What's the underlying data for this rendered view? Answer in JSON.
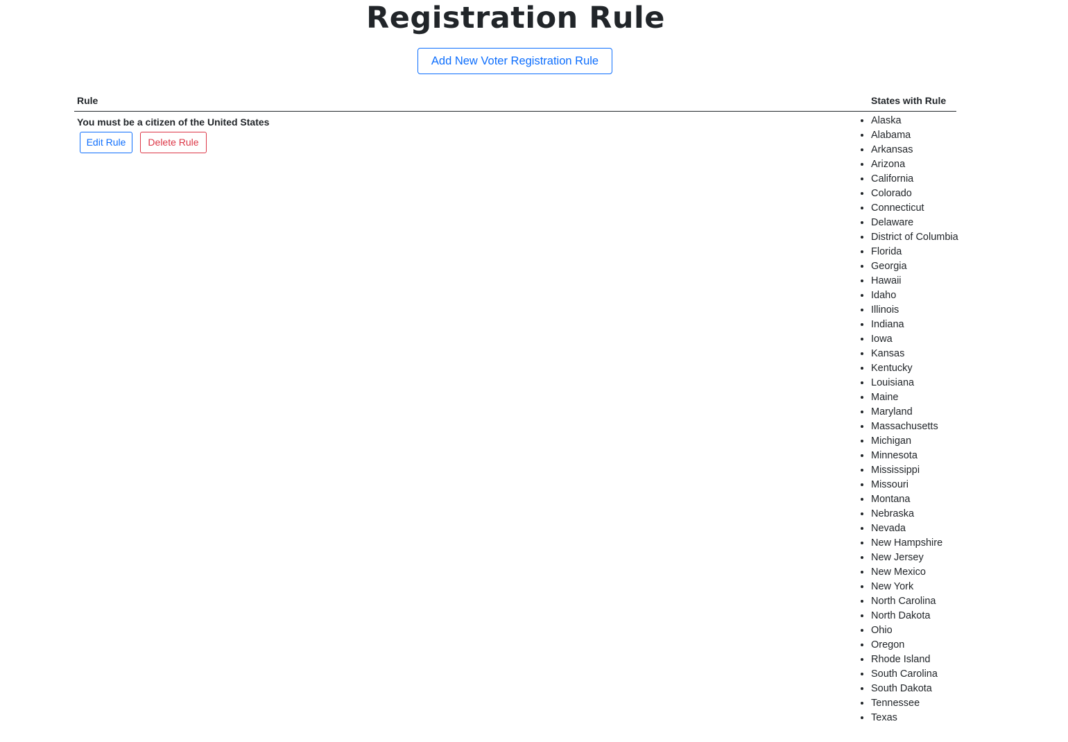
{
  "page": {
    "title": "Registration Rule",
    "add_button_label": "Add New Voter Registration Rule"
  },
  "table": {
    "headers": {
      "rule": "Rule",
      "states": "States with Rule"
    },
    "rows": [
      {
        "rule": "You must be a citizen of the United States",
        "edit_label": "Edit Rule",
        "delete_label": "Delete Rule",
        "states": [
          "Alaska",
          "Alabama",
          "Arkansas",
          "Arizona",
          "California",
          "Colorado",
          "Connecticut",
          "Delaware",
          "District of Columbia",
          "Florida",
          "Georgia",
          "Hawaii",
          "Idaho",
          "Illinois",
          "Indiana",
          "Iowa",
          "Kansas",
          "Kentucky",
          "Louisiana",
          "Maine",
          "Maryland",
          "Massachusetts",
          "Michigan",
          "Minnesota",
          "Mississippi",
          "Missouri",
          "Montana",
          "Nebraska",
          "Nevada",
          "New Hampshire",
          "New Jersey",
          "New Mexico",
          "New York",
          "North Carolina",
          "North Dakota",
          "Ohio",
          "Oregon",
          "Rhode Island",
          "South Carolina",
          "South Dakota",
          "Tennessee",
          "Texas"
        ]
      }
    ]
  },
  "colors": {
    "primary": "#0d6efd",
    "danger": "#dc3545",
    "text": "#212529"
  }
}
